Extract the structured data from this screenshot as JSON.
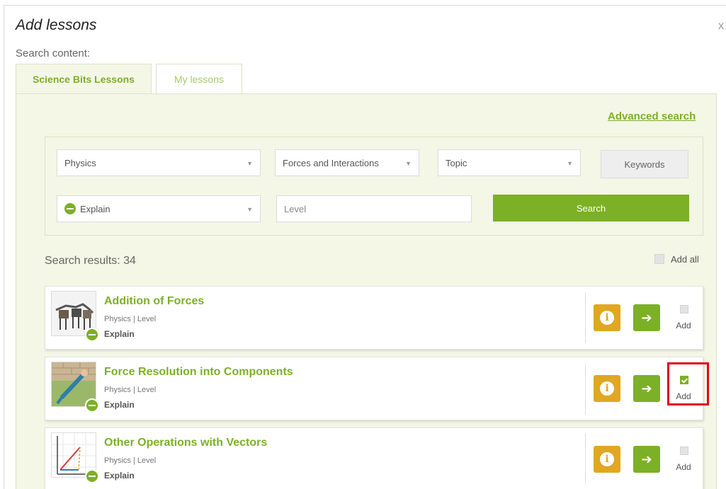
{
  "dialog": {
    "title": "Add lessons",
    "close_symbol": "x",
    "search_label": "Search content:"
  },
  "tabs": [
    {
      "label": "Science Bits Lessons",
      "active": true
    },
    {
      "label": "My lessons",
      "active": false
    }
  ],
  "advanced_search": "Advanced search",
  "filters": {
    "subject": "Physics",
    "unit": "Forces and Interactions",
    "topic": "Topic",
    "keywords_placeholder": "Keywords",
    "phase": "Explain",
    "level_placeholder": "Level",
    "search_button": "Search"
  },
  "results": {
    "label": "Search results: 34",
    "add_all_label": "Add all"
  },
  "lessons": [
    {
      "title": "Addition of Forces",
      "meta": "Physics | Level",
      "phase": "Explain",
      "add_label": "Add",
      "checked": false,
      "thumb_icon": "horses-pulling-icon"
    },
    {
      "title": "Force Resolution into Components",
      "meta": "Physics | Level",
      "phase": "Explain",
      "add_label": "Add",
      "checked": true,
      "thumb_icon": "person-leaning-icon"
    },
    {
      "title": "Other Operations with Vectors",
      "meta": "Physics | Level",
      "phase": "Explain",
      "add_label": "Add",
      "checked": false,
      "thumb_icon": "vector-graph-icon"
    }
  ],
  "colors": {
    "accent_green": "#7cb027",
    "info_orange": "#e0a723",
    "panel_bg": "#f4f6e6",
    "highlight_red": "#e0001b"
  }
}
